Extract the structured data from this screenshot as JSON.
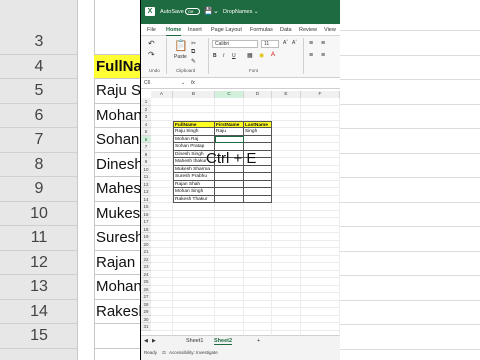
{
  "background": {
    "row_numbers": [
      "3",
      "4",
      "5",
      "6",
      "7",
      "8",
      "9",
      "10",
      "11",
      "12",
      "13",
      "14",
      "15"
    ],
    "cells": [
      "",
      "FullNam",
      "Raju Sin",
      "Mohan",
      "Sohan R",
      "Dinesh",
      "Mahesh",
      "Mukesh",
      "Suresh",
      "Rajan S",
      "Mohan",
      "Rakesh",
      ""
    ]
  },
  "titlebar": {
    "logo": "X",
    "autosave_label": "AutoSave",
    "toggle_label": "Off",
    "filename": "DropNames ⌄"
  },
  "tabs": [
    "File",
    "Home",
    "Insert",
    "Page Layout",
    "Formulas",
    "Data",
    "Review",
    "View"
  ],
  "active_tab": "Home",
  "ribbon": {
    "paste_label": "Paste",
    "font_name": "Calibri",
    "font_size": "11",
    "group_undo": "Undo",
    "group_clipboard": "Clipboard",
    "group_font": "Font",
    "bold": "B",
    "italic": "I",
    "underline": "U"
  },
  "formula_bar": {
    "name_box": "C6",
    "fx": "fx"
  },
  "columns": [
    "A",
    "B",
    "C",
    "D",
    "E",
    "F"
  ],
  "rows": [
    "1",
    "2",
    "3",
    "4",
    "5",
    "6",
    "7",
    "8",
    "9",
    "10",
    "11",
    "12",
    "13",
    "14",
    "15",
    "16",
    "17",
    "18",
    "19",
    "20",
    "21",
    "22",
    "23",
    "24",
    "25",
    "26",
    "27",
    "28",
    "29",
    "30",
    "31"
  ],
  "table": {
    "headers": [
      "FullName",
      "FirstName",
      "LastName"
    ],
    "rows": [
      [
        "Raju Singh",
        "Raju",
        "Singh"
      ],
      [
        "Mohan Raj",
        "",
        ""
      ],
      [
        "Sohan Pratap",
        "",
        ""
      ],
      [
        "Dinesh Singh",
        "",
        ""
      ],
      [
        "Mahesh thakur",
        "",
        ""
      ],
      [
        "Mukesh Sharma",
        "",
        ""
      ],
      [
        "Suresh Prabhu",
        "",
        ""
      ],
      [
        "Rajan Shah",
        "",
        ""
      ],
      [
        "Mohan Singh",
        "",
        ""
      ],
      [
        "Rakesh Thakur",
        "",
        ""
      ]
    ]
  },
  "overlay_text": "Ctrl + E",
  "sheets": [
    "Sheet1",
    "Sheet2"
  ],
  "active_sheet": "Sheet2",
  "add_sheet": "+",
  "status": {
    "ready": "Ready",
    "accessibility": "Accessibility: Investigate"
  },
  "colors": {
    "excel_green": "#1e6b41",
    "header_yellow": "#ffff22"
  }
}
